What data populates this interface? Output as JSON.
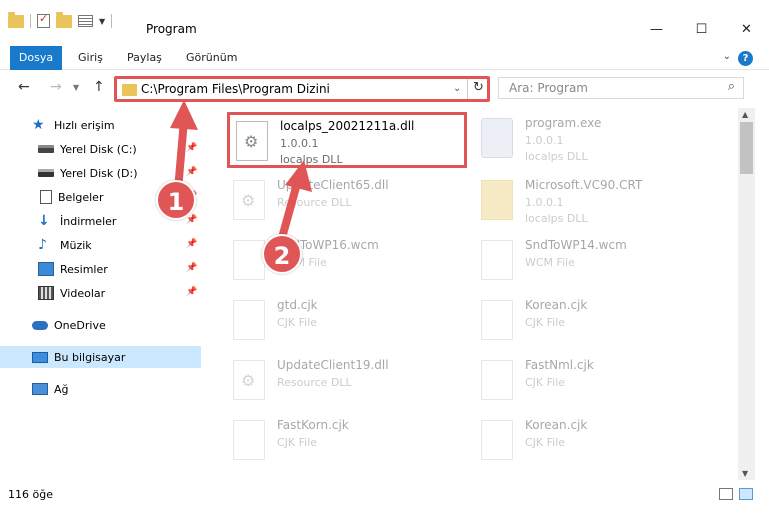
{
  "window": {
    "title": "Program",
    "minimize": "—",
    "maximize": "☐",
    "close": "✕"
  },
  "ribbon": {
    "tabs": [
      "Dosya",
      "Giriş",
      "Paylaş",
      "Görünüm"
    ],
    "help": "?"
  },
  "navigation": {
    "back": "←",
    "forward": "→",
    "up": "↑",
    "address_path": "C:\\Program Files\\Program Dizini",
    "search_placeholder": "Ara: Program"
  },
  "sidebar": {
    "items": [
      {
        "label": "Hızlı erişim",
        "icon": "star-icon"
      },
      {
        "label": "Yerel Disk (C:)",
        "icon": "drive-icon",
        "pinned": true
      },
      {
        "label": "Yerel Disk (D:)",
        "icon": "drive-icon",
        "pinned": true
      },
      {
        "label": "Belgeler",
        "icon": "documents-icon",
        "pinned": true
      },
      {
        "label": "İndirmeler",
        "icon": "download-icon",
        "pinned": true
      },
      {
        "label": "Müzik",
        "icon": "music-icon",
        "pinned": true
      },
      {
        "label": "Resimler",
        "icon": "pictures-icon",
        "pinned": true
      },
      {
        "label": "Videolar",
        "icon": "videos-icon",
        "pinned": true
      },
      {
        "label": "OneDrive",
        "icon": "cloud-icon"
      },
      {
        "label": "Bu bilgisayar",
        "icon": "computer-icon",
        "selected": true
      },
      {
        "label": "Ağ",
        "icon": "network-icon"
      }
    ]
  },
  "files": [
    {
      "name": "localps_20021211a.dll",
      "line2": "1.0.0.1",
      "line3": "localps DLL",
      "icon": "dll-file-icon",
      "highlighted": true
    },
    {
      "name": "program.exe",
      "line2": "1.0.0.1",
      "line3": "localps DLL",
      "icon": "exe-file-icon"
    },
    {
      "name": "UpdateClient65.dll",
      "line2": "Resource DLL",
      "line3": "",
      "icon": "dll-file-icon"
    },
    {
      "name": "Microsoft.VC90.CRT",
      "line2": "1.0.0.1",
      "line3": "localps DLL",
      "icon": "folder-icon"
    },
    {
      "name": "SndToWP16.wcm",
      "line2": "WCM File",
      "line3": "",
      "icon": "generic-file-icon"
    },
    {
      "name": "SndToWP14.wcm",
      "line2": "WCM File",
      "line3": "",
      "icon": "generic-file-icon"
    },
    {
      "name": "gtd.cjk",
      "line2": "CJK File",
      "line3": "",
      "icon": "generic-file-icon"
    },
    {
      "name": "Korean.cjk",
      "line2": "CJK File",
      "line3": "",
      "icon": "generic-file-icon"
    },
    {
      "name": "UpdateClient19.dll",
      "line2": "Resource DLL",
      "line3": "",
      "icon": "dll-file-icon"
    },
    {
      "name": "FastNml.cjk",
      "line2": "CJK File",
      "line3": "",
      "icon": "generic-file-icon"
    },
    {
      "name": "FastKorn.cjk",
      "line2": "CJK File",
      "line3": "",
      "icon": "generic-file-icon"
    },
    {
      "name": "Korean.cjk",
      "line2": "CJK File",
      "line3": "",
      "icon": "generic-file-icon"
    }
  ],
  "status": {
    "item_count": "116 öğe"
  },
  "callouts": [
    "1",
    "2"
  ],
  "colors": {
    "accent": "#1979ca",
    "highlight": "#e05656",
    "selection": "#cce8ff"
  }
}
